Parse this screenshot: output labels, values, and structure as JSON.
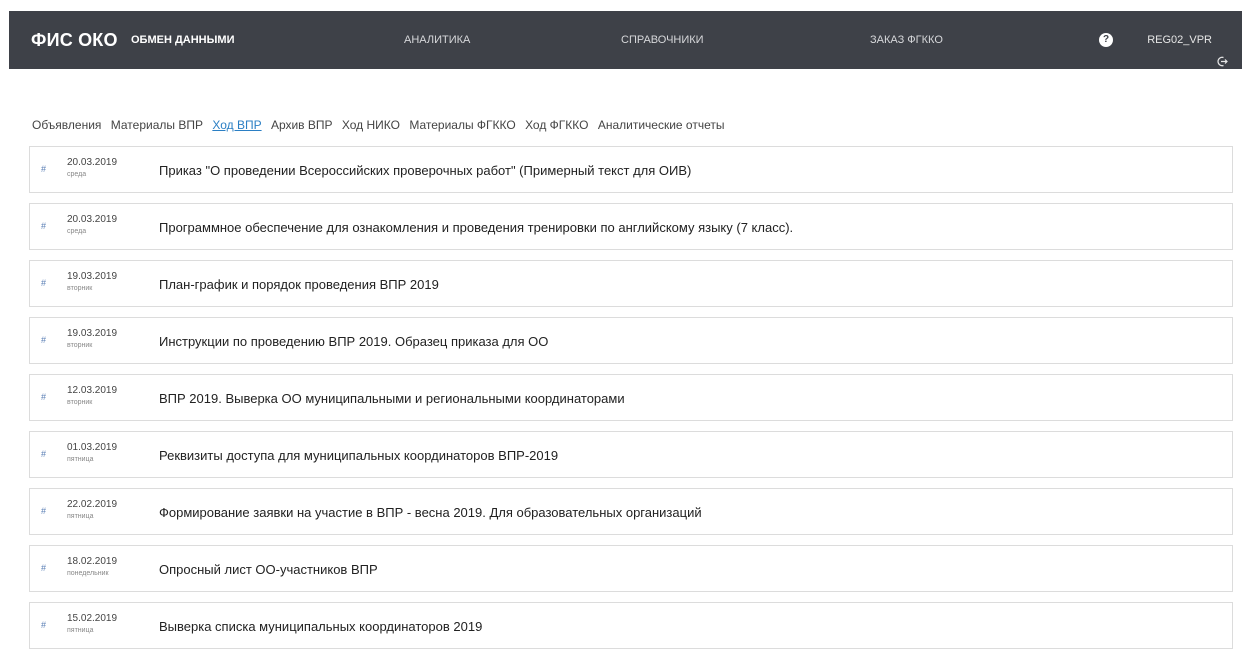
{
  "header": {
    "brand": "ФИС ОКО",
    "nav": [
      {
        "label": "ОБМЕН ДАННЫМИ",
        "active": true
      },
      {
        "label": "АНАЛИТИКА",
        "active": false
      },
      {
        "label": "СПРАВОЧНИКИ",
        "active": false
      },
      {
        "label": "ЗАКАЗ ФГККО",
        "active": false
      }
    ],
    "help_icon": "?",
    "user": "REG02_VPR"
  },
  "subnav": [
    {
      "label": "Объявления",
      "current": false
    },
    {
      "label": "Материалы ВПР",
      "current": false
    },
    {
      "label": "Ход ВПР",
      "current": true
    },
    {
      "label": "Архив ВПР",
      "current": false
    },
    {
      "label": "Ход НИКО",
      "current": false
    },
    {
      "label": "Материалы ФГККО",
      "current": false
    },
    {
      "label": "Ход ФГККО",
      "current": false
    },
    {
      "label": "Аналитические отчеты",
      "current": false
    }
  ],
  "news": [
    {
      "hash": "#",
      "date": "20.03.2019",
      "weekday": "среда",
      "title": "Приказ \"О проведении Всероссийских проверочных работ\" (Примерный текст для ОИВ)"
    },
    {
      "hash": "#",
      "date": "20.03.2019",
      "weekday": "среда",
      "title": "Программное обеспечение для ознакомления и проведения тренировки по английскому языку (7 класс)."
    },
    {
      "hash": "#",
      "date": "19.03.2019",
      "weekday": "вторник",
      "title": "План-график и порядок проведения ВПР 2019"
    },
    {
      "hash": "#",
      "date": "19.03.2019",
      "weekday": "вторник",
      "title": "Инструкции по проведению ВПР 2019. Образец приказа для ОО"
    },
    {
      "hash": "#",
      "date": "12.03.2019",
      "weekday": "вторник",
      "title": "ВПР 2019. Выверка ОО муниципальными и региональными координаторами"
    },
    {
      "hash": "#",
      "date": "01.03.2019",
      "weekday": "пятница",
      "title": "Реквизиты доступа для муниципальных координаторов ВПР-2019"
    },
    {
      "hash": "#",
      "date": "22.02.2019",
      "weekday": "пятница",
      "title": "Формирование заявки на участие в ВПР - весна 2019. Для образовательных организаций"
    },
    {
      "hash": "#",
      "date": "18.02.2019",
      "weekday": "понедельник",
      "title": "Опросный лист ОО-участников ВПР"
    },
    {
      "hash": "#",
      "date": "15.02.2019",
      "weekday": "пятница",
      "title": "Выверка списка муниципальных координаторов 2019"
    }
  ]
}
